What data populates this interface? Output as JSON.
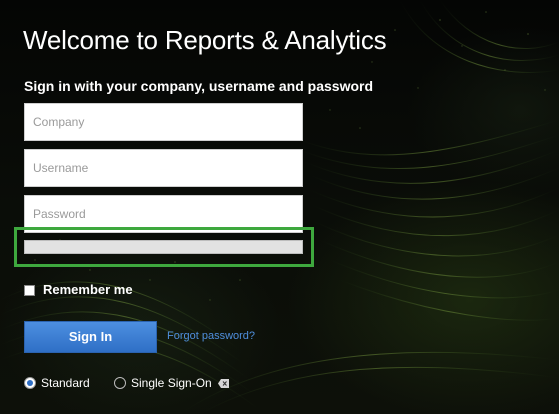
{
  "header": {
    "title": "Welcome to Reports & Analytics",
    "subtitle": "Sign in with your company, username and password"
  },
  "form": {
    "company_placeholder": "Company",
    "username_placeholder": "Username",
    "password_placeholder": "Password",
    "remember_label": "Remember me",
    "remember_checked": false,
    "signin_label": "Sign In",
    "forgot_label": "Forgot password?"
  },
  "login_type": {
    "standard_label": "Standard",
    "sso_label": "Single Sign-On",
    "selected": "Standard",
    "sso_icon": "eraser-icon"
  },
  "colors": {
    "accent_button": "#2f6fc6",
    "link": "#4f8fdd",
    "highlight": "#3ea83e",
    "background": "#000000"
  }
}
